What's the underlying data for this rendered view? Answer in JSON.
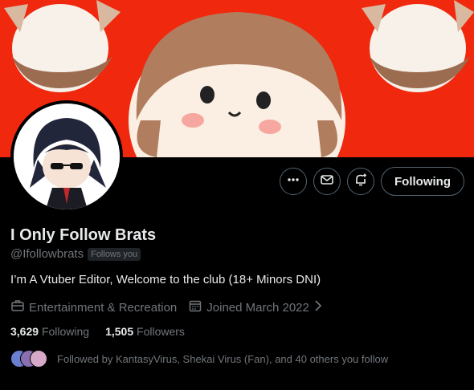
{
  "profile": {
    "name": "I Only Follow Brats",
    "handle": "@Ifollowbrats",
    "follows_you": "Follows you",
    "bio": "I’m A Vtuber Editor, Welcome to the club (18+ Minors DNI)",
    "category": "Entertainment & Recreation",
    "joined": "Joined March 2022",
    "following_count": "3,629",
    "following_label": "Following",
    "followers_count": "1,505",
    "followers_label": "Followers",
    "followed_by": "Followed by KantasyVirus, Shekai Virus (Fan), and 40 others you follow"
  },
  "actions": {
    "follow_state": "Following"
  },
  "colors": {
    "banner": "#f0280e",
    "text": "#e7e9ea",
    "muted": "#71767b",
    "border": "#536471"
  },
  "icons": [
    "more-icon",
    "message-icon",
    "notification-bell-icon",
    "briefcase-icon",
    "calendar-icon",
    "chevron-right-icon"
  ]
}
